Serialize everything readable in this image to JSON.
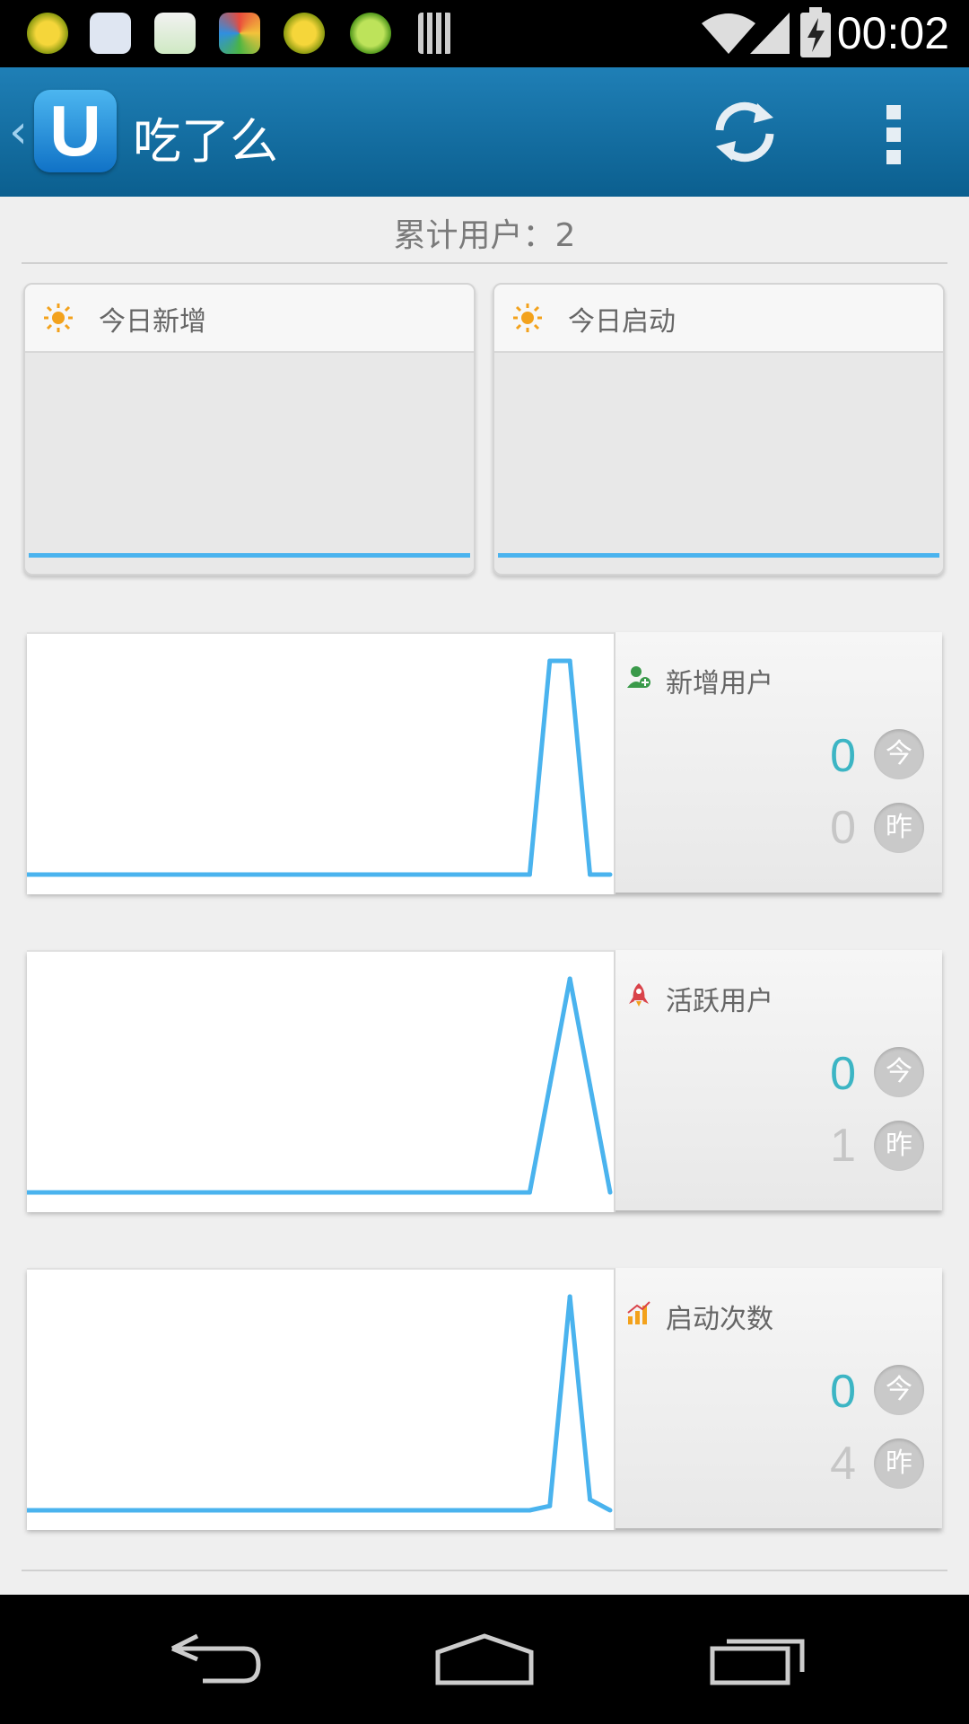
{
  "status_bar": {
    "time": "00:02",
    "notification_icons": [
      "green-plus-icon",
      "baidu-paw-icon",
      "map-pin-icon",
      "pinwheel-icon",
      "sync-plus-icon",
      "upload-arrow-icon",
      "barcode-icon"
    ],
    "system_icons": [
      "wifi-icon",
      "signal-icon",
      "battery-charging-icon"
    ]
  },
  "header": {
    "app_title": "吃了么",
    "logo_letter": "U",
    "actions": [
      "refresh-icon",
      "overflow-menu-icon"
    ]
  },
  "summary": {
    "total_users_label": "累计用户：2"
  },
  "today_cards": [
    {
      "label": "今日新增",
      "icon": "sun-icon"
    },
    {
      "label": "今日启动",
      "icon": "sun-icon"
    }
  ],
  "stats": [
    {
      "title": "新增用户",
      "icon": "user-add-icon",
      "today": "0",
      "yesterday": "0",
      "today_badge": "今",
      "yesterday_badge": "昨"
    },
    {
      "title": "活跃用户",
      "icon": "rocket-icon",
      "today": "0",
      "yesterday": "1",
      "today_badge": "今",
      "yesterday_badge": "昨"
    },
    {
      "title": "启动次数",
      "icon": "bar-chart-icon",
      "today": "0",
      "yesterday": "4",
      "today_badge": "今",
      "yesterday_badge": "昨"
    }
  ],
  "chart_data": [
    {
      "type": "line",
      "series": [
        {
          "values": [
            0,
            0,
            0,
            0,
            0,
            0,
            0,
            0,
            0,
            0,
            0,
            0,
            0,
            0,
            0,
            0,
            0,
            0,
            0,
            0,
            0,
            0,
            0,
            0,
            0,
            0,
            0,
            0,
            0,
            0
          ]
        }
      ]
    },
    {
      "type": "line",
      "series": [
        {
          "values": [
            0,
            0,
            0,
            0,
            0,
            0,
            0,
            0,
            0,
            0,
            0,
            0,
            0,
            0,
            0,
            0,
            0,
            0,
            0,
            0,
            0,
            0,
            0,
            0,
            0,
            0,
            0,
            0,
            0,
            0
          ]
        }
      ]
    },
    {
      "type": "line",
      "series": [
        {
          "values": [
            0,
            0,
            0,
            0,
            0,
            0,
            0,
            0,
            0,
            0,
            0,
            0,
            0,
            0,
            0,
            0,
            0,
            0,
            0,
            0,
            0,
            0,
            0,
            0,
            0,
            0,
            1,
            1,
            0,
            0
          ]
        }
      ]
    },
    {
      "type": "line",
      "series": [
        {
          "values": [
            0,
            0,
            0,
            0,
            0,
            0,
            0,
            0,
            0,
            0,
            0,
            0,
            0,
            0,
            0,
            0,
            0,
            0,
            0,
            0,
            0,
            0,
            0,
            0,
            0,
            0,
            0.5,
            1,
            0.5,
            0
          ]
        }
      ]
    },
    {
      "type": "line",
      "series": [
        {
          "values": [
            0,
            0,
            0,
            0,
            0,
            0,
            0,
            0,
            0,
            0,
            0,
            0,
            0,
            0,
            0,
            0,
            0,
            0,
            0,
            0,
            0,
            0,
            0,
            0,
            0,
            0,
            0.02,
            1,
            0.05,
            0
          ]
        }
      ]
    }
  ],
  "colors": {
    "accent": "#4ab3ee",
    "header": "#136f9f",
    "today_value": "#3cb5c4"
  }
}
